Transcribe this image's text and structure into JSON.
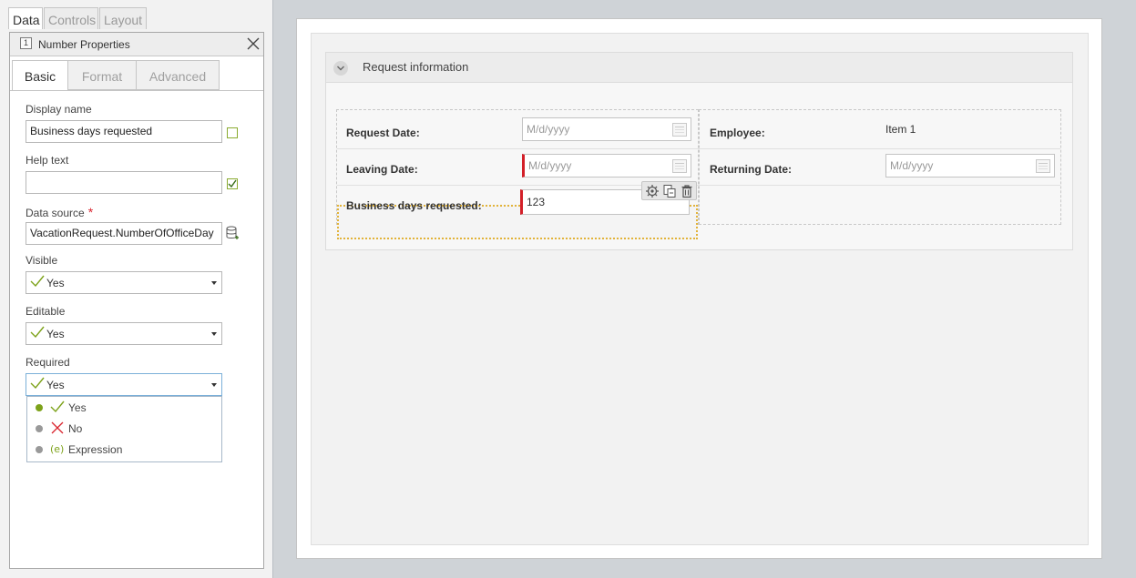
{
  "top_tabs": [
    {
      "label": "Data",
      "active": true
    },
    {
      "label": "Controls",
      "active": false
    },
    {
      "label": "Layout",
      "active": false
    }
  ],
  "properties_panel": {
    "title": "Number Properties",
    "icon_text": "1",
    "sub_tabs": [
      {
        "label": "Basic",
        "active": true
      },
      {
        "label": "Format",
        "active": false
      },
      {
        "label": "Advanced",
        "active": false
      }
    ],
    "display_name": {
      "label": "Display name",
      "value": "Business days requested"
    },
    "help_text": {
      "label": "Help text",
      "value": ""
    },
    "data_source": {
      "label": "Data source",
      "required_mark": "*",
      "value": "VacationRequest.NumberOfOfficeDay"
    },
    "visible": {
      "label": "Visible",
      "value": "Yes"
    },
    "editable": {
      "label": "Editable",
      "value": "Yes"
    },
    "required": {
      "label": "Required",
      "value": "Yes"
    },
    "required_options": [
      {
        "label": "Yes",
        "icon": "check-icon",
        "selected": true
      },
      {
        "label": "No",
        "icon": "x-icon",
        "selected": false
      },
      {
        "label": "Expression",
        "icon": "expression-icon",
        "selected": false
      }
    ]
  },
  "form": {
    "section_title": "Request information",
    "request_date": {
      "label": "Request Date:",
      "placeholder": "M/d/yyyy"
    },
    "leaving_date": {
      "label": "Leaving Date:",
      "placeholder": "M/d/yyyy"
    },
    "business_days": {
      "label": "Business days requested:",
      "value": "123"
    },
    "employee": {
      "label": "Employee:",
      "value": "Item 1"
    },
    "returning_date": {
      "label": "Returning Date:",
      "placeholder": "M/d/yyyy"
    }
  },
  "colors": {
    "accent_green": "#7da21a",
    "required_red": "#d31f28",
    "selection_outline": "#e2b33a"
  }
}
